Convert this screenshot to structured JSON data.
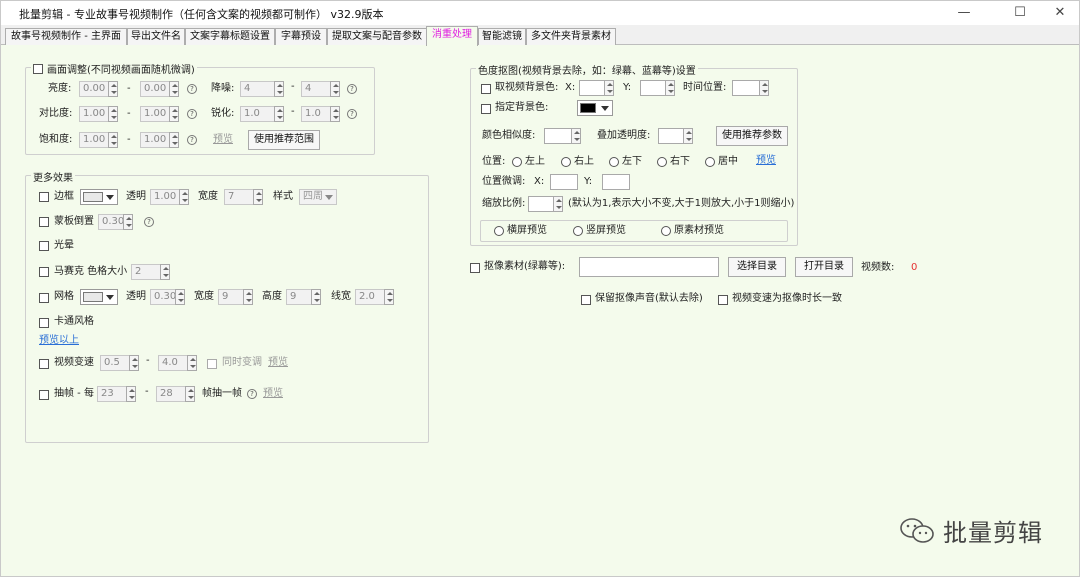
{
  "window": {
    "title": "批量剪辑 - 专业故事号视频制作（任何含文案的视频都可制作） v32.9版本",
    "minimize": "—",
    "maximize": "☐",
    "close": "✕"
  },
  "tabs": [
    "故事号视频制作 - 主界面",
    "导出文件名",
    "文案字幕标题设置",
    "字幕预设",
    "提取文案与配音参数",
    "消重处理",
    "智能滤镜",
    "多文件夹背景素材"
  ],
  "picture": {
    "group_title": "画面调整(不同视频画面随机微调)",
    "brightness_label": "亮度:",
    "brightness_min": "0.00",
    "brightness_max": "0.00",
    "contrast_label": "对比度:",
    "contrast_min": "1.00",
    "contrast_max": "1.00",
    "saturation_label": "饱和度:",
    "saturation_min": "1.00",
    "saturation_max": "1.00",
    "denoise_label": "降噪:",
    "denoise_min": "4",
    "denoise_max": "4",
    "sharpen_label": "锐化:",
    "sharpen_min": "1.0",
    "sharpen_max": "1.0",
    "preview": "预览",
    "recommend_button": "使用推荐范围",
    "dash": "-",
    "help": "?"
  },
  "effects": {
    "group_title": "更多效果",
    "border_label": "边框",
    "border_opacity_label": "透明",
    "border_opacity": "1.00",
    "border_width_label": "宽度",
    "border_width": "7",
    "border_style_label": "样式",
    "border_style_value": "四周",
    "mask_label": "蒙板倒置",
    "mask_value": "0.30",
    "halo_label": "光晕",
    "mosaic_label": "马赛克 色格大小",
    "mosaic_value": "2",
    "grid_label": "网格",
    "grid_opacity_label": "透明",
    "grid_opacity": "0.30",
    "grid_width_label": "宽度",
    "grid_width": "9",
    "grid_height_label": "高度",
    "grid_height": "9",
    "grid_line_label": "线宽",
    "grid_line": "2.0",
    "cartoon_label": "卡通风格",
    "preview_above": "预览以上",
    "speed_label": "视频变速",
    "speed_min": "0.5",
    "speed_max": "4.0",
    "sync_label": "同时变调",
    "speed_preview": "预览",
    "frame_label": "抽帧 - 每",
    "frame_min": "23",
    "frame_max": "28",
    "frame_suffix": "帧抽一帧",
    "frame_preview": "预览"
  },
  "chroma": {
    "group_title": "色度抠图(视频背景去除，如：绿幕、蓝幕等)设置",
    "take_color_label": "取视频背景色:",
    "x_label": "X:",
    "y_label": "Y:",
    "time_label": "时间位置:",
    "specify_label": "指定背景色:",
    "similarity_label": "颜色相似度:",
    "blend_label": "叠加透明度:",
    "recommend_button": "使用推荐参数",
    "position_label": "位置:",
    "positions": [
      "左上",
      "右上",
      "左下",
      "右下",
      "居中"
    ],
    "position_preview": "预览",
    "fine_label": "位置微调:",
    "fx_label": "X:",
    "fy_label": "Y:",
    "scale_label": "缩放比例:",
    "scale_hint": "(默认为1,表示大小不变,大于1则放大,小于1则缩小)",
    "preview_options": [
      "横屏预览",
      "竖屏预览",
      "原素材预览"
    ]
  },
  "keying": {
    "label": "抠像素材(绿幕等):",
    "path": "",
    "choose_button": "选择目录",
    "open_button": "打开目录",
    "count_label": "视频数:",
    "count": "0",
    "keep_audio_label": "保留抠像声音(默认去除)",
    "speed_match_label": "视频变速为抠像时长一致"
  },
  "watermark": {
    "text": "批量剪辑"
  },
  "colors": {
    "accent_tab": "#e020e0",
    "bg": "#f4fbec",
    "link": "#2a6fd6",
    "count": "#e53030"
  }
}
